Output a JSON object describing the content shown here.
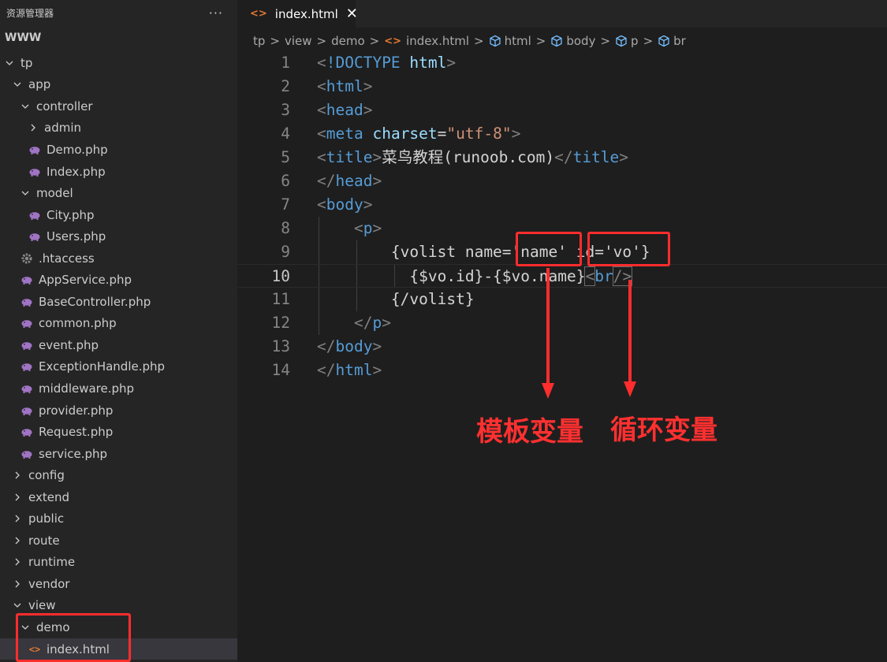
{
  "sidebar": {
    "title": "资源管理器",
    "more_icon": "more-icon",
    "workspace": "WWW",
    "tree": [
      {
        "label": "tp",
        "type": "folder",
        "open": true,
        "depth": 0
      },
      {
        "label": "app",
        "type": "folder",
        "open": true,
        "depth": 1
      },
      {
        "label": "controller",
        "type": "folder",
        "open": true,
        "depth": 2
      },
      {
        "label": "admin",
        "type": "folder",
        "open": false,
        "depth": 3
      },
      {
        "label": "Demo.php",
        "type": "php",
        "depth": 3
      },
      {
        "label": "Index.php",
        "type": "php",
        "depth": 3
      },
      {
        "label": "model",
        "type": "folder",
        "open": true,
        "depth": 2
      },
      {
        "label": "City.php",
        "type": "php",
        "depth": 3
      },
      {
        "label": "Users.php",
        "type": "php",
        "depth": 3
      },
      {
        "label": ".htaccess",
        "type": "gear",
        "depth": 2
      },
      {
        "label": "AppService.php",
        "type": "php",
        "depth": 2
      },
      {
        "label": "BaseController.php",
        "type": "php",
        "depth": 2
      },
      {
        "label": "common.php",
        "type": "php",
        "depth": 2
      },
      {
        "label": "event.php",
        "type": "php",
        "depth": 2
      },
      {
        "label": "ExceptionHandle.php",
        "type": "php",
        "depth": 2
      },
      {
        "label": "middleware.php",
        "type": "php",
        "depth": 2
      },
      {
        "label": "provider.php",
        "type": "php",
        "depth": 2
      },
      {
        "label": "Request.php",
        "type": "php",
        "depth": 2
      },
      {
        "label": "service.php",
        "type": "php",
        "depth": 2
      },
      {
        "label": "config",
        "type": "folder",
        "open": false,
        "depth": 1
      },
      {
        "label": "extend",
        "type": "folder",
        "open": false,
        "depth": 1
      },
      {
        "label": "public",
        "type": "folder",
        "open": false,
        "depth": 1
      },
      {
        "label": "route",
        "type": "folder",
        "open": false,
        "depth": 1
      },
      {
        "label": "runtime",
        "type": "folder",
        "open": false,
        "depth": 1
      },
      {
        "label": "vendor",
        "type": "folder",
        "open": false,
        "depth": 1
      },
      {
        "label": "view",
        "type": "folder",
        "open": true,
        "depth": 1
      },
      {
        "label": "demo",
        "type": "folder",
        "open": true,
        "depth": 2
      },
      {
        "label": "index.html",
        "type": "html",
        "depth": 3,
        "selected": true
      }
    ]
  },
  "tab": {
    "label": "index.html",
    "file_icon": "<>",
    "close_icon": "✕"
  },
  "breadcrumb": {
    "items": [
      "tp",
      "view",
      "demo",
      "index.html",
      "html",
      "body",
      "p",
      "br"
    ],
    "separator": ">"
  },
  "editor": {
    "current_line": 10,
    "lines": [
      {
        "n": 1,
        "tokens": [
          [
            "br",
            "<"
          ],
          [
            "dt",
            "!DOCTYPE"
          ],
          [
            "txt",
            " "
          ],
          [
            "attr",
            "html"
          ],
          [
            "br",
            ">"
          ]
        ]
      },
      {
        "n": 2,
        "tokens": [
          [
            "br",
            "<"
          ],
          [
            "tag",
            "html"
          ],
          [
            "br",
            ">"
          ]
        ]
      },
      {
        "n": 3,
        "tokens": [
          [
            "br",
            "<"
          ],
          [
            "tag",
            "head"
          ],
          [
            "br",
            ">"
          ]
        ]
      },
      {
        "n": 4,
        "tokens": [
          [
            "br",
            "<"
          ],
          [
            "tag",
            "meta"
          ],
          [
            "txt",
            " "
          ],
          [
            "attr",
            "charset"
          ],
          [
            "txt",
            "="
          ],
          [
            "str",
            "\"utf-8\""
          ],
          [
            "br",
            ">"
          ]
        ]
      },
      {
        "n": 5,
        "tokens": [
          [
            "br",
            "<"
          ],
          [
            "tag",
            "title"
          ],
          [
            "br",
            ">"
          ],
          [
            "txt",
            "菜鸟教程(runoob.com)"
          ],
          [
            "br",
            "</"
          ],
          [
            "tag",
            "title"
          ],
          [
            "br",
            ">"
          ]
        ]
      },
      {
        "n": 6,
        "tokens": [
          [
            "br",
            "</"
          ],
          [
            "tag",
            "head"
          ],
          [
            "br",
            ">"
          ]
        ]
      },
      {
        "n": 7,
        "tokens": [
          [
            "br",
            "<"
          ],
          [
            "tag",
            "body"
          ],
          [
            "br",
            ">"
          ]
        ]
      },
      {
        "n": 8,
        "tokens": [
          [
            "txt",
            "    "
          ],
          [
            "br",
            "<"
          ],
          [
            "tag",
            "p"
          ],
          [
            "br",
            ">"
          ]
        ]
      },
      {
        "n": 9,
        "tokens": [
          [
            "txt",
            "        {volist name='name' id='vo'}"
          ]
        ]
      },
      {
        "n": 10,
        "tokens": [
          [
            "txt",
            "          {$vo.id}-{$vo.name}"
          ],
          [
            "br",
            "<"
          ],
          [
            "tag",
            "br"
          ],
          [
            "br",
            "/>"
          ]
        ]
      },
      {
        "n": 11,
        "tokens": [
          [
            "txt",
            "        {/volist}"
          ]
        ]
      },
      {
        "n": 12,
        "tokens": [
          [
            "txt",
            "    "
          ],
          [
            "br",
            "</"
          ],
          [
            "tag",
            "p"
          ],
          [
            "br",
            ">"
          ]
        ]
      },
      {
        "n": 13,
        "tokens": [
          [
            "br",
            "</"
          ],
          [
            "tag",
            "body"
          ],
          [
            "br",
            ">"
          ]
        ]
      },
      {
        "n": 14,
        "tokens": [
          [
            "br",
            "</"
          ],
          [
            "tag",
            "html"
          ],
          [
            "br",
            ">"
          ]
        ]
      }
    ]
  },
  "annotations": {
    "label_left": "模板变量",
    "label_right": "循环变量",
    "color": "#ff2d2d"
  },
  "colors": {
    "tag": "#569cd6",
    "attr": "#9cdcfe",
    "string": "#ce9178",
    "text": "#d4d4d4",
    "bracket": "#808080",
    "php_icon": "#a074c4",
    "html_icon": "#e37933"
  }
}
